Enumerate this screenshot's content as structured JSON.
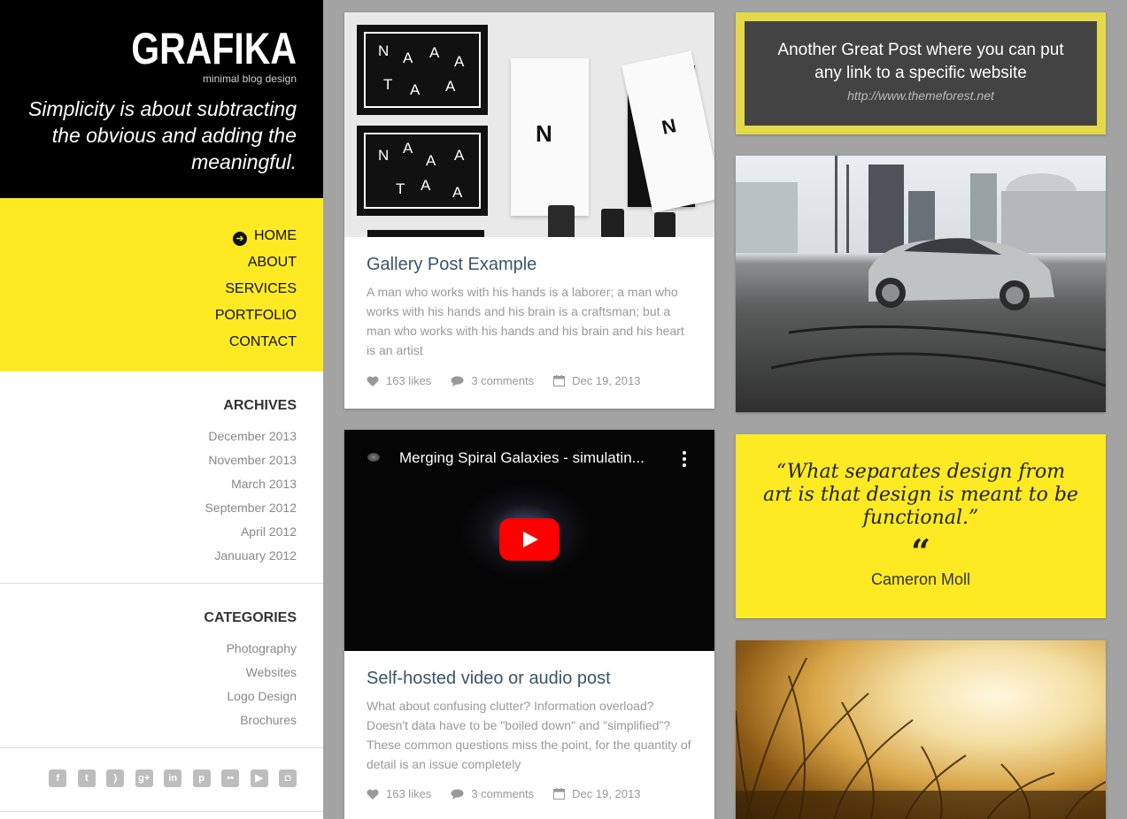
{
  "brand": {
    "logo": "GRAFIKA",
    "tagline": "minimal blog design",
    "quote": "Simplicity is about subtracting the obvious and adding the meaningful."
  },
  "nav": {
    "items": [
      {
        "label": "HOME",
        "active": true
      },
      {
        "label": "ABOUT"
      },
      {
        "label": "SERVICES"
      },
      {
        "label": "PORTFOLIO"
      },
      {
        "label": "CONTACT"
      }
    ]
  },
  "archives": {
    "title": "ARCHIVES",
    "items": [
      "December 2013",
      "November 2013",
      "March 2013",
      "September 2012",
      "April 2012",
      "Januuary 2012"
    ]
  },
  "categories": {
    "title": "CATEGORIES",
    "items": [
      "Photography",
      "Websites",
      "Logo Design",
      "Brochures"
    ]
  },
  "social": {
    "icons": [
      "facebook-icon",
      "twitter-icon",
      "rss-icon",
      "google-plus-icon",
      "linkedin-icon",
      "pinterest-icon",
      "flickr-icon",
      "youtube-icon",
      "instagram-icon"
    ]
  },
  "posts": {
    "gallery": {
      "title": "Gallery Post Example",
      "excerpt": "A man who works with his hands is a laborer; a man who works with his hands and his brain is a craftsman; but a man who works with his hands and his brain and his heart is an artist",
      "likes": "163 likes",
      "comments": "3 comments",
      "date": "Dec 19, 2013"
    },
    "video": {
      "video_title": "Merging Spiral Galaxies - simulatin...",
      "title": "Self-hosted video or audio post",
      "excerpt": "What about confusing clutter? Information overload? Doesn't data have to be \"boiled down\" and \"simplified\"? These common questions miss the point, for the quantity of detail is an issue completely",
      "likes": "163 likes",
      "comments": "3 comments",
      "date": "Dec 19, 2013"
    },
    "link": {
      "title": "Another Great Post where you can put any link to a specific website",
      "url": "http://www.themeforest.net"
    },
    "quote": {
      "text": "“What separates design from art is that design is meant to be functional.”",
      "mark": "“",
      "author": "Cameron Moll"
    }
  },
  "colors": {
    "accent_yellow": "#fdea23",
    "link_frame": "#e3d94a",
    "dark": "#434343",
    "title_blue": "#3a5568"
  }
}
